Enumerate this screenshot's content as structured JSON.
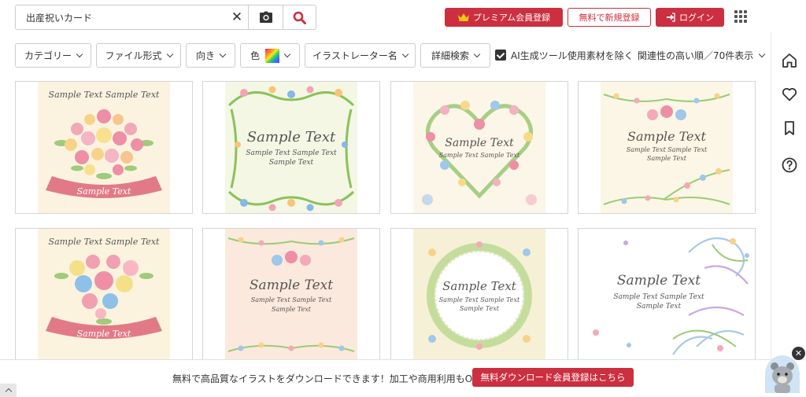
{
  "search": {
    "value": "出産祝いカード"
  },
  "header": {
    "premium_label": "プレミアム会員登録",
    "register_label": "無料で新規登録",
    "login_label": "ログイン"
  },
  "filters": {
    "category": "カテゴリー",
    "file_format": "ファイル形式",
    "orientation": "向き",
    "color": "色",
    "illustrator": "イラストレーター名",
    "advanced": "詳細検索",
    "ai_exclude": "AI生成ツール使用素材を除く",
    "sort": "関連性の高い順／70件表示"
  },
  "sample": {
    "big": "Sample Text",
    "small_pair": "Sample Text  Sample Text",
    "small": "Sample Text"
  },
  "banner": {
    "text": "無料で高品質なイラストをダウンロードできます！加工や商用利用もOK！",
    "button": "無料ダウンロード会員登録はこちら"
  },
  "colors": {
    "accent": "#cc2f3f"
  }
}
